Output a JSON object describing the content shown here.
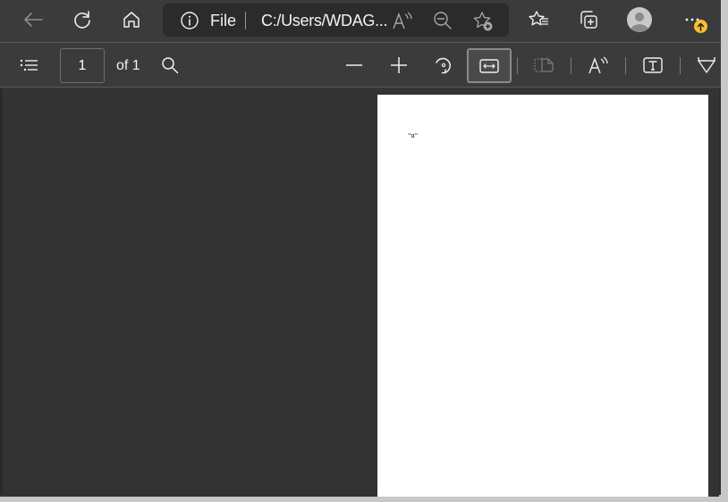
{
  "browser": {
    "nav": {
      "back_icon": "arrow-left-icon",
      "refresh_icon": "refresh-icon",
      "home_icon": "home-icon"
    },
    "address_bar": {
      "info_icon": "info-icon",
      "scheme": "File",
      "url": "C:/Users/WDAG...",
      "read_aloud_icon": "read-aloud-icon",
      "zoom_out_icon": "zoom-out-icon",
      "add_favorite_icon": "star-add-icon"
    },
    "toolbar": {
      "favorites_icon": "favorites-list-icon",
      "collections_icon": "collections-icon",
      "profile_icon": "profile-avatar-icon",
      "menu_icon": "more-dots-icon",
      "update_badge_icon": "update-arrow-icon",
      "update_badge_color": "#f7c02f"
    }
  },
  "pdf_toolbar": {
    "contents_icon": "table-of-contents-icon",
    "page_number": "1",
    "page_total_label": "of 1",
    "search_icon": "search-icon",
    "zoom_out_icon": "minus-icon",
    "zoom_in_icon": "plus-icon",
    "rotate_icon": "rotate-icon",
    "fit_width_icon": "fit-to-width-icon",
    "fit_width_active": true,
    "page_view_icon": "two-page-view-icon",
    "page_view_enabled": false,
    "read_aloud_icon": "read-aloud-icon",
    "add_text_icon": "add-text-icon",
    "draw_icon": "draw-icon"
  },
  "document": {
    "page_text": "\"α\""
  }
}
